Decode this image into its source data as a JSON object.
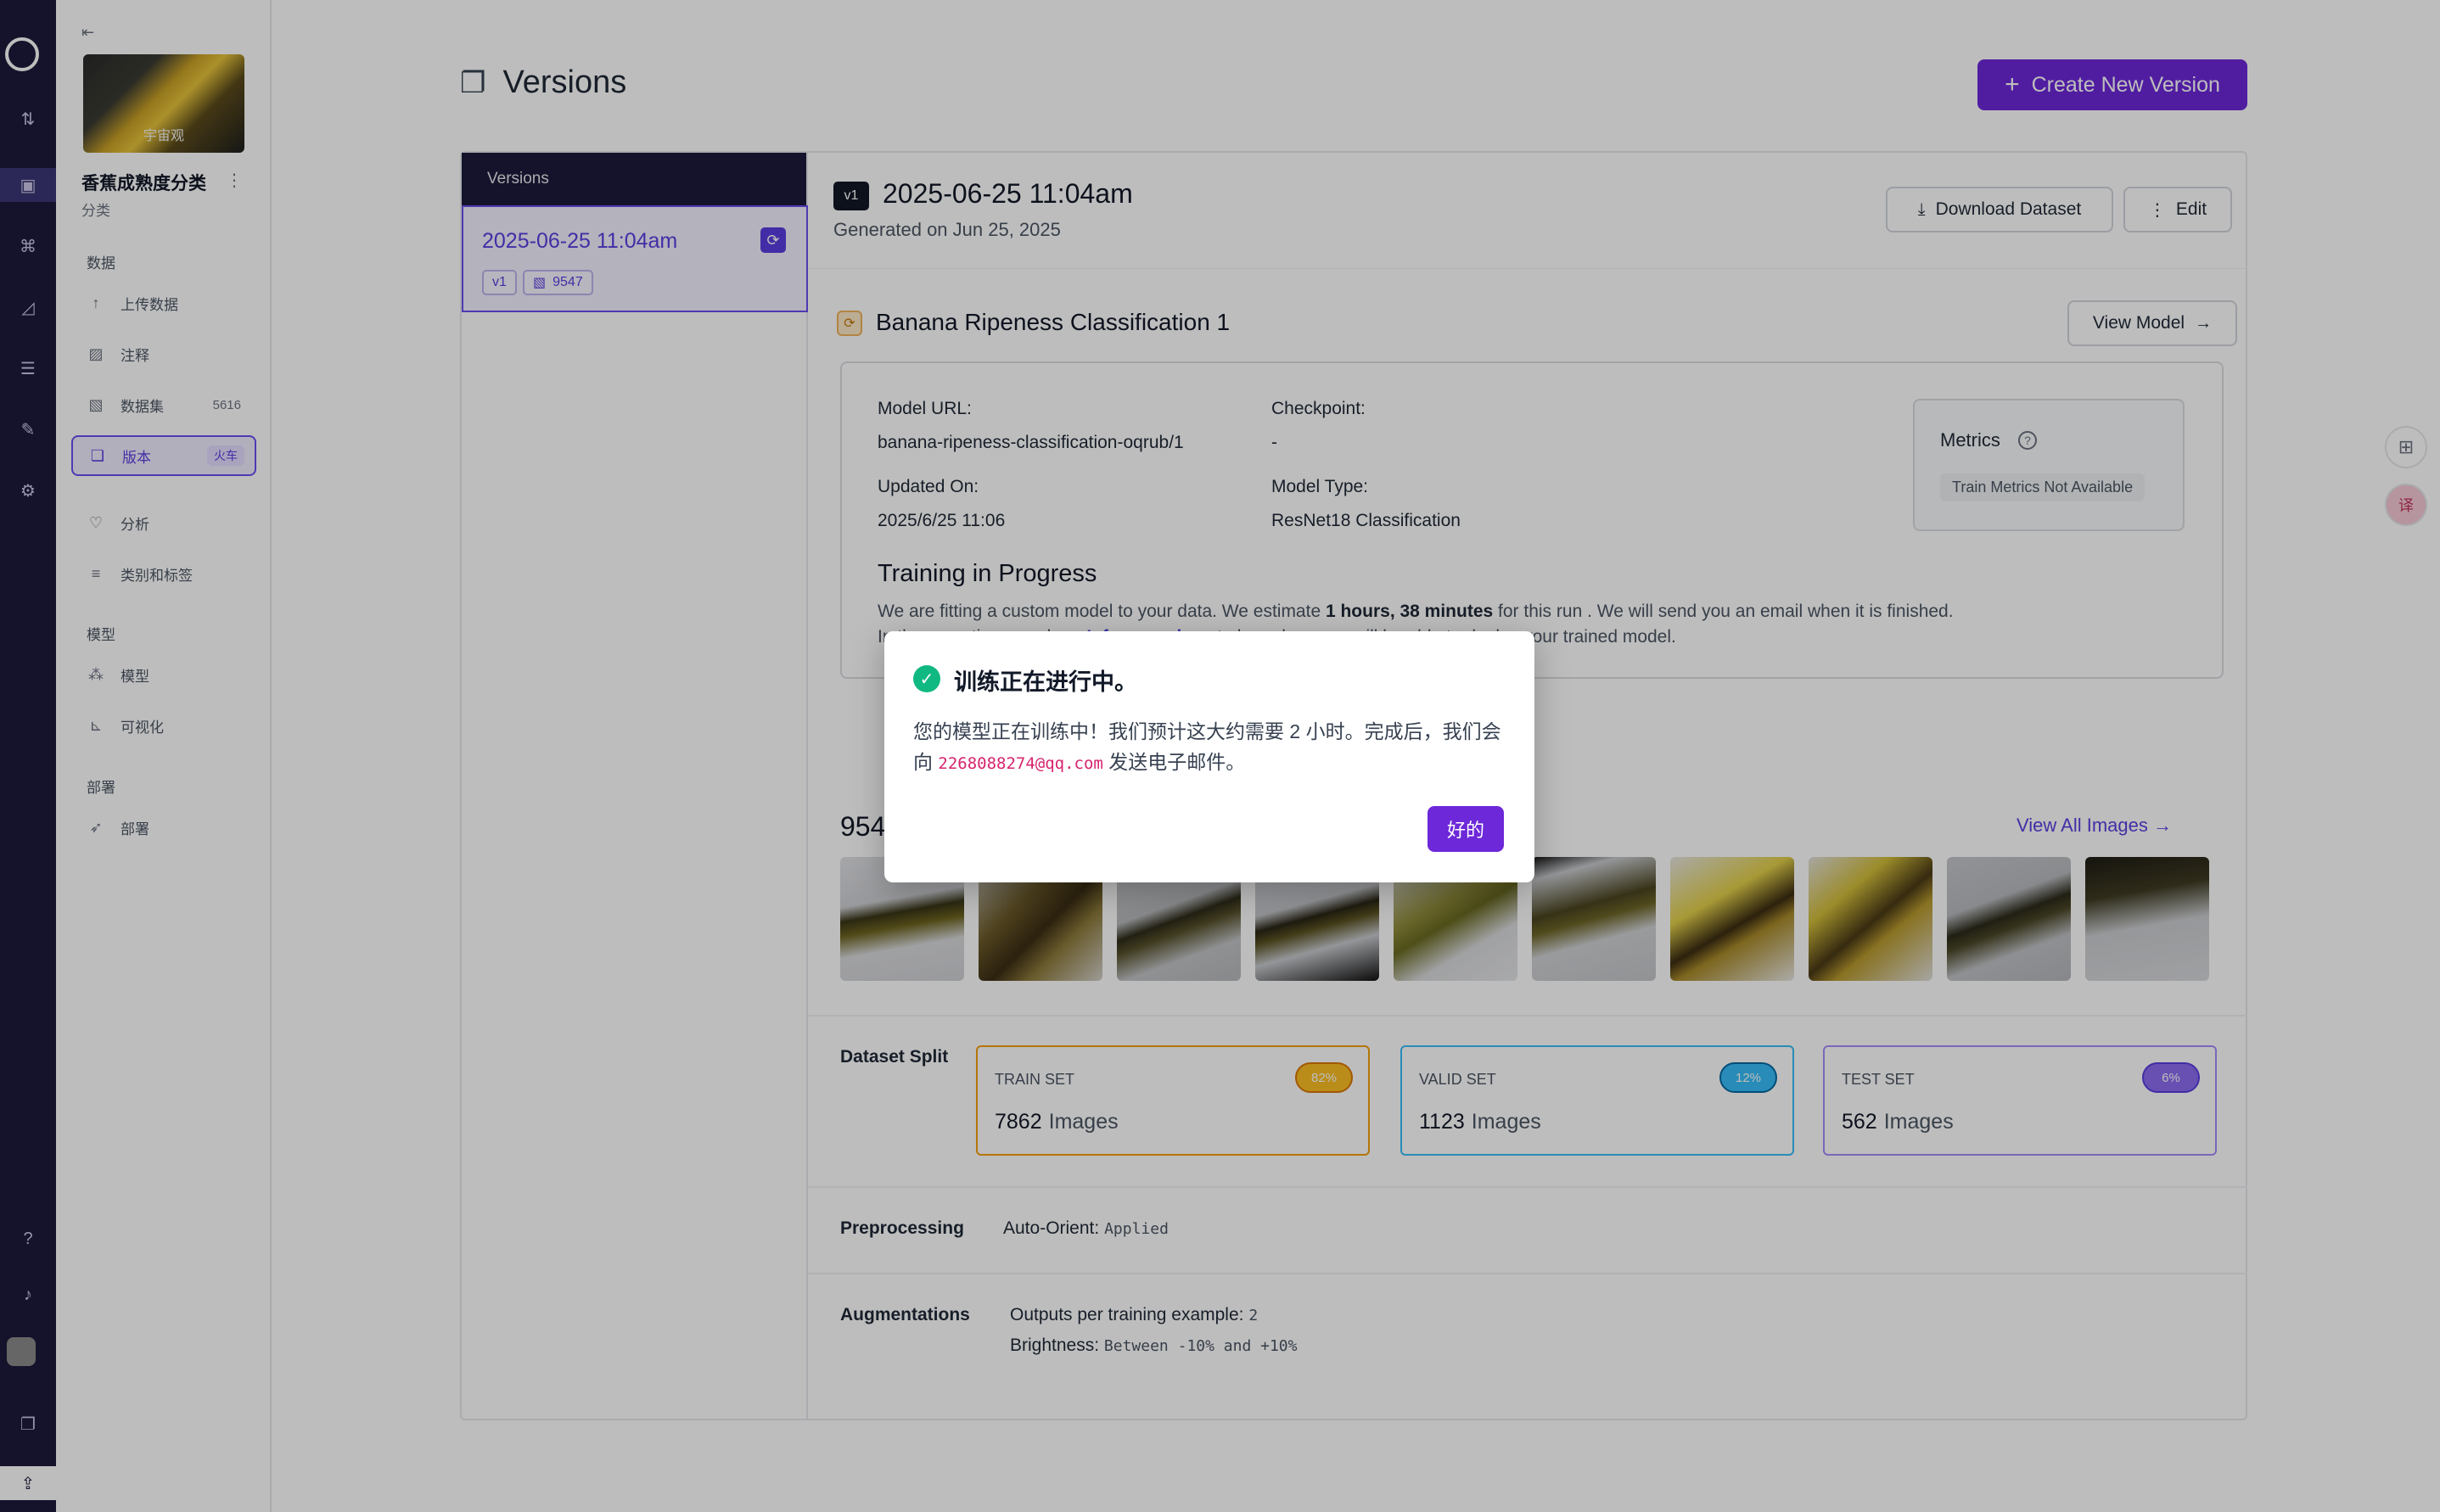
{
  "rail": {
    "icons": [
      "logo-icon",
      "swap-icon",
      "inbox-icon",
      "hierarchy-icon",
      "chart-icon",
      "server-icon",
      "brush-icon",
      "gear-icon",
      "help-icon",
      "bell-icon",
      "avatar",
      "layers-icon",
      "upload-icon"
    ]
  },
  "sidebar": {
    "toggle": "⇤",
    "project_thumb_label": "宇宙观",
    "project_name": "香蕉成熟度分类",
    "project_type": "分类",
    "sections": {
      "data": "数据",
      "models": "模型",
      "deploy": "部署"
    },
    "items": [
      {
        "label": "上传数据",
        "icon": "upload-arrow-icon"
      },
      {
        "label": "注释",
        "icon": "annotate-icon"
      },
      {
        "label": "数据集",
        "icon": "image-icon",
        "count": "5616"
      },
      {
        "label": "版本",
        "icon": "versions-icon",
        "badge": "火车"
      },
      {
        "label": "分析",
        "icon": "heart-pulse-icon"
      },
      {
        "label": "类别和标签",
        "icon": "list-icon"
      },
      {
        "label": "模型",
        "icon": "model-icon"
      },
      {
        "label": "可视化",
        "icon": "visualize-icon"
      },
      {
        "label": "部署",
        "icon": "rocket-icon"
      }
    ]
  },
  "header": {
    "title": "Versions",
    "create_button": "Create New Version"
  },
  "version_list": {
    "heading": "Versions",
    "items": [
      {
        "date": "2025-06-25 11:04am",
        "version_tag": "v1",
        "image_count": "9547"
      }
    ]
  },
  "detail": {
    "version_badge": "v1",
    "title": "2025-06-25 11:04am",
    "generated": "Generated on Jun 25, 2025",
    "download_button": "Download Dataset",
    "edit_button": "Edit",
    "model": {
      "name": "Banana Ripeness Classification 1",
      "view_button": "View Model",
      "url_label": "Model URL:",
      "url_value": "banana-ripeness-classification-oqrub/1",
      "checkpoint_label": "Checkpoint:",
      "checkpoint_value": "-",
      "updated_label": "Updated On:",
      "updated_value": "2025/6/25 11:06",
      "type_label": "Model Type:",
      "type_value": "ResNet18 Classification",
      "metrics_title": "Metrics",
      "metrics_na": "Train Metrics Not Available",
      "training_title": "Training in Progress",
      "training_p1": "We are fitting a custom model to your data. We estimate ",
      "training_bold": "1 hours, 38 minutes",
      "training_p2": " for this run . We will send you an email when it is finished.",
      "training_p3": "In the meantime, read our ",
      "training_link": "Inference docs",
      "training_p4": " to learn how you will be able to deploy your trained model."
    },
    "images": {
      "count_label": "954",
      "view_all": "View All Images"
    },
    "split": {
      "label": "Dataset Split",
      "sets": [
        {
          "name": "TRAIN SET",
          "pct": "82%",
          "count": "7862",
          "unit": "Images",
          "color": "#f59e0b"
        },
        {
          "name": "VALID SET",
          "pct": "12%",
          "count": "1123",
          "unit": "Images",
          "color": "#0ea5e9"
        },
        {
          "name": "TEST SET",
          "pct": "6%",
          "count": "562",
          "unit": "Images",
          "color": "#7c5ce0"
        }
      ]
    },
    "preprocessing": {
      "label": "Preprocessing",
      "key": "Auto-Orient:",
      "value": "Applied"
    },
    "augmentations": {
      "label": "Augmentations",
      "k1": "Outputs per training example:",
      "v1": "2",
      "k2": "Brightness:",
      "v2": "Between -10% and +10%"
    }
  },
  "modal": {
    "title": "训练正在进行中。",
    "body_1": "您的模型正在训练中！我们预计这大约需要 2 小时。完成后，我们会向 ",
    "email": "2268088274@qq.com",
    "body_2": " 发送电子邮件。",
    "ok_button": "好的"
  },
  "colors": {
    "accent": "#6d28d9",
    "rail": "#1c1a3a",
    "success": "#10b981"
  }
}
